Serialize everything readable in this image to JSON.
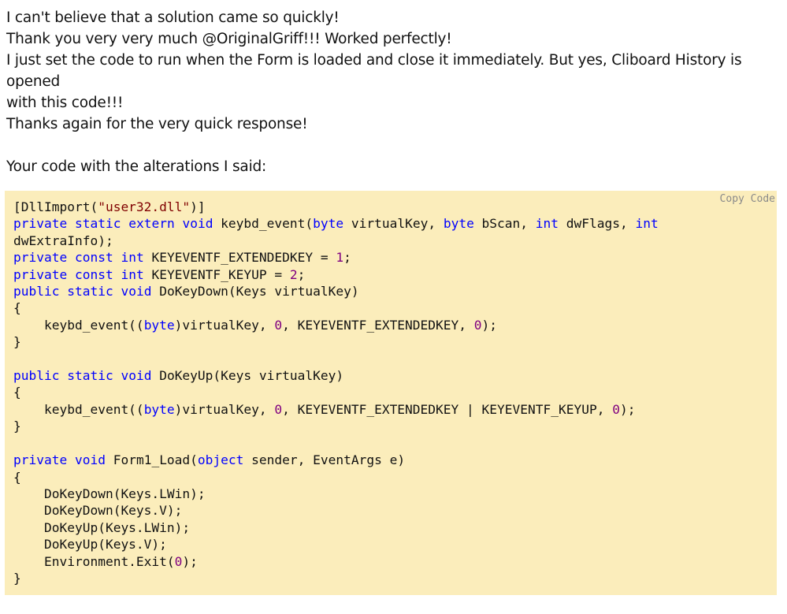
{
  "post": {
    "paragraphs": [
      "I can't believe that a solution came so quickly!",
      "Thank you very very much @OriginalGriff!!! Worked perfectly!",
      "I just set the code to run when the Form is loaded and close it immediately. But yes, Cliboard History is opened",
      "with this code!!!",
      "Thanks again for the very quick response!",
      "",
      "Your code with the alterations I said:"
    ]
  },
  "code_block": {
    "copy_label": "Copy Code",
    "background": "#fbedbb",
    "colors": {
      "keyword": "#0000ff",
      "string": "#800000",
      "number": "#800080",
      "text": "#111111"
    },
    "lines": [
      [
        [
          "t",
          "[DllImport("
        ],
        [
          "s",
          "\"user32.dll\""
        ],
        [
          "t",
          ")]"
        ]
      ],
      [
        [
          "k",
          "private"
        ],
        [
          "t",
          " "
        ],
        [
          "k",
          "static"
        ],
        [
          "t",
          " "
        ],
        [
          "k",
          "extern"
        ],
        [
          "t",
          " "
        ],
        [
          "k",
          "void"
        ],
        [
          "t",
          " keybd_event("
        ],
        [
          "k",
          "byte"
        ],
        [
          "t",
          " virtualKey, "
        ],
        [
          "k",
          "byte"
        ],
        [
          "t",
          " bScan, "
        ],
        [
          "k",
          "int"
        ],
        [
          "t",
          " dwFlags, "
        ],
        [
          "k",
          "int"
        ]
      ],
      [
        [
          "t",
          "dwExtraInfo);"
        ]
      ],
      [
        [
          "k",
          "private"
        ],
        [
          "t",
          " "
        ],
        [
          "k",
          "const"
        ],
        [
          "t",
          " "
        ],
        [
          "k",
          "int"
        ],
        [
          "t",
          " KEYEVENTF_EXTENDEDKEY = "
        ],
        [
          "n",
          "1"
        ],
        [
          "t",
          ";"
        ]
      ],
      [
        [
          "k",
          "private"
        ],
        [
          "t",
          " "
        ],
        [
          "k",
          "const"
        ],
        [
          "t",
          " "
        ],
        [
          "k",
          "int"
        ],
        [
          "t",
          " KEYEVENTF_KEYUP = "
        ],
        [
          "n",
          "2"
        ],
        [
          "t",
          ";"
        ]
      ],
      [
        [
          "k",
          "public"
        ],
        [
          "t",
          " "
        ],
        [
          "k",
          "static"
        ],
        [
          "t",
          " "
        ],
        [
          "k",
          "void"
        ],
        [
          "t",
          " DoKeyDown(Keys virtualKey)"
        ]
      ],
      [
        [
          "t",
          "{"
        ]
      ],
      [
        [
          "t",
          "    keybd_event(("
        ],
        [
          "k",
          "byte"
        ],
        [
          "t",
          ")virtualKey, "
        ],
        [
          "n",
          "0"
        ],
        [
          "t",
          ", KEYEVENTF_EXTENDEDKEY, "
        ],
        [
          "n",
          "0"
        ],
        [
          "t",
          ");"
        ]
      ],
      [
        [
          "t",
          "}"
        ]
      ],
      [],
      [
        [
          "k",
          "public"
        ],
        [
          "t",
          " "
        ],
        [
          "k",
          "static"
        ],
        [
          "t",
          " "
        ],
        [
          "k",
          "void"
        ],
        [
          "t",
          " DoKeyUp(Keys virtualKey)"
        ]
      ],
      [
        [
          "t",
          "{"
        ]
      ],
      [
        [
          "t",
          "    keybd_event(("
        ],
        [
          "k",
          "byte"
        ],
        [
          "t",
          ")virtualKey, "
        ],
        [
          "n",
          "0"
        ],
        [
          "t",
          ", KEYEVENTF_EXTENDEDKEY | KEYEVENTF_KEYUP, "
        ],
        [
          "n",
          "0"
        ],
        [
          "t",
          ");"
        ]
      ],
      [
        [
          "t",
          "}"
        ]
      ],
      [],
      [
        [
          "k",
          "private"
        ],
        [
          "t",
          " "
        ],
        [
          "k",
          "void"
        ],
        [
          "t",
          " Form1_Load("
        ],
        [
          "k",
          "object"
        ],
        [
          "t",
          " sender, EventArgs e)"
        ]
      ],
      [
        [
          "t",
          "{"
        ]
      ],
      [
        [
          "t",
          "    DoKeyDown(Keys.LWin);"
        ]
      ],
      [
        [
          "t",
          "    DoKeyDown(Keys.V);"
        ]
      ],
      [
        [
          "t",
          "    DoKeyUp(Keys.LWin);"
        ]
      ],
      [
        [
          "t",
          "    DoKeyUp(Keys.V);"
        ]
      ],
      [
        [
          "t",
          "    Environment.Exit("
        ],
        [
          "n",
          "0"
        ],
        [
          "t",
          ");"
        ]
      ],
      [
        [
          "t",
          "}"
        ]
      ]
    ]
  }
}
